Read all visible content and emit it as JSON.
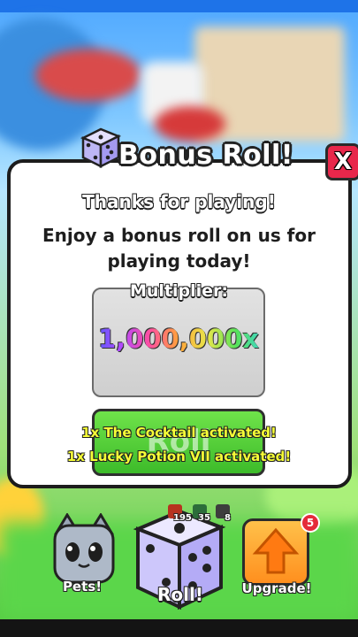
{
  "dialog": {
    "title": "Bonus Roll!",
    "close_label": "X",
    "thanks": "Thanks for playing!",
    "description": "Enjoy a bonus roll on us for playing today!",
    "multiplier_label": "Multiplier:",
    "multiplier_value": "1,000,000x",
    "roll_button_label": "Roll",
    "notices": [
      "1x The Cocktail activated!",
      "1x Lucky Potion VII activated!"
    ]
  },
  "hud": {
    "pets_label": "Pets!",
    "roll_label": "Roll!",
    "upgrade_label": "Upgrade!",
    "upgrade_badge": "5",
    "potion_counts": [
      "195",
      "35",
      "8"
    ]
  },
  "icons": {
    "title": "dice-icon",
    "close": "close-icon",
    "pets": "cat-icon",
    "roll": "dice-icon",
    "upgrade": "arrow-up-icon"
  },
  "colors": {
    "close": "#e8274b",
    "roll_button": "#4fcf35",
    "notice_text": "#f7ff37",
    "upgrade": "#ff9a27",
    "badge": "#e52a3a"
  }
}
